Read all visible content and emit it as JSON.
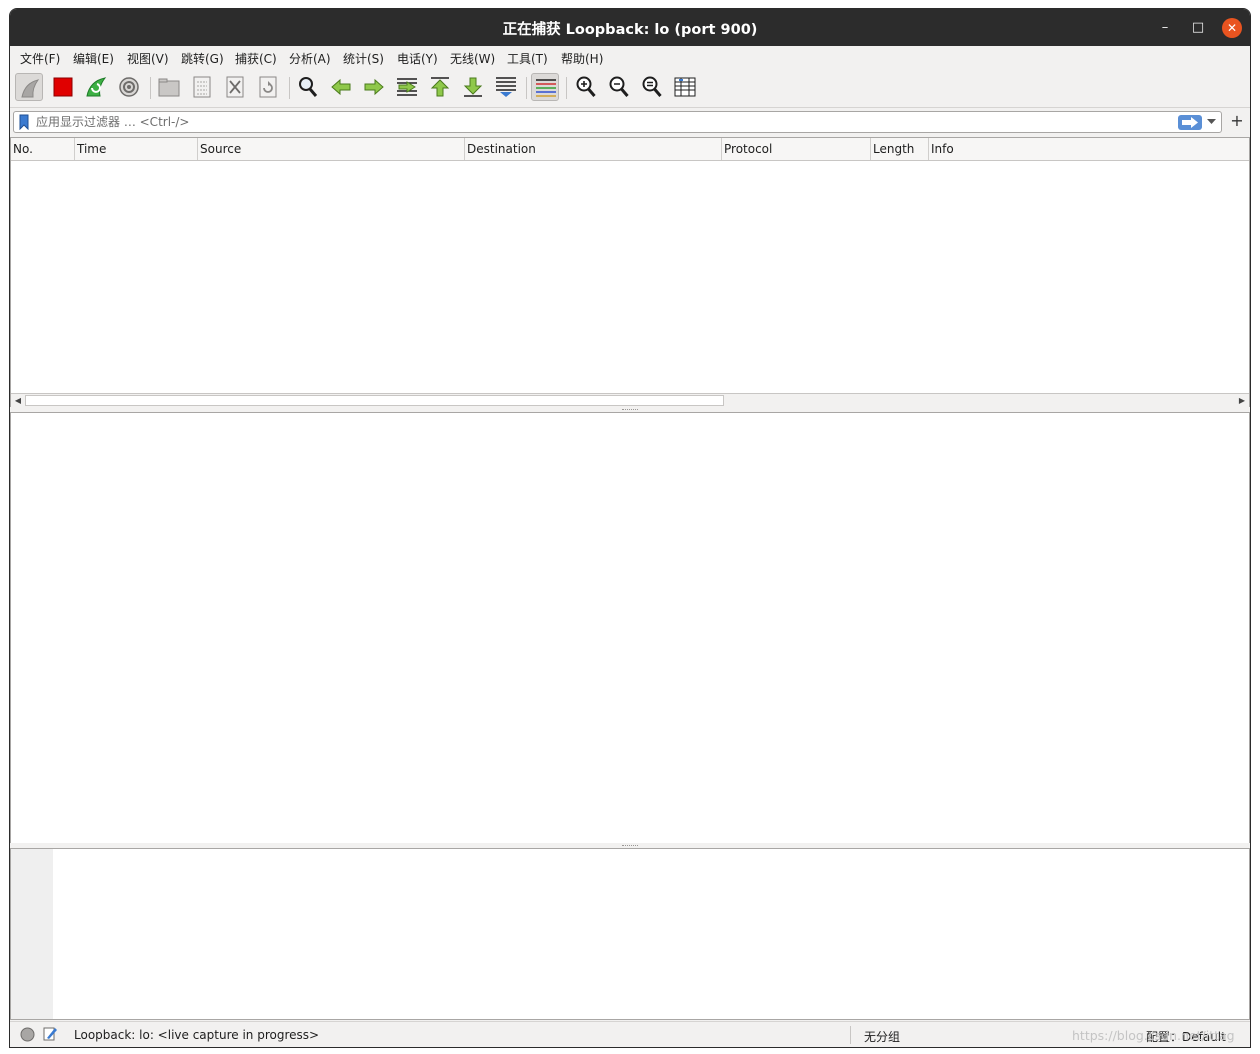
{
  "window": {
    "title": "正在捕获 Loopback: lo (port 900)",
    "controls": {
      "minimize": "–",
      "maximize": "□",
      "close": "✕"
    }
  },
  "menu": [
    "文件(F)",
    "编辑(E)",
    "视图(V)",
    "跳转(G)",
    "捕获(C)",
    "分析(A)",
    "统计(S)",
    "电话(Y)",
    "无线(W)",
    "工具(T)",
    "帮助(H)"
  ],
  "toolbar": {
    "icons": [
      "shark-fin-start-icon",
      "stop-capture-icon",
      "restart-capture-icon",
      "capture-options-gear-icon",
      "open-file-icon",
      "save-file-icon",
      "close-file-icon",
      "reload-file-icon",
      "find-packet-icon",
      "go-back-icon",
      "go-forward-icon",
      "go-to-packet-icon",
      "go-first-packet-icon",
      "go-last-packet-icon",
      "auto-scroll-icon",
      "colorize-icon",
      "zoom-in-icon",
      "zoom-out-icon",
      "zoom-normal-icon",
      "resize-columns-icon"
    ],
    "colors": {
      "stop": "#e00000",
      "arrow_green": "#5aa02c",
      "shark_green": "#3cb043"
    }
  },
  "filter": {
    "placeholder": "应用显示过滤器 … <Ctrl-/>",
    "add_label": "+"
  },
  "packet_list": {
    "columns": [
      "No.",
      "Time",
      "Source",
      "Destination",
      "Protocol",
      "Length",
      "Info"
    ],
    "rows": []
  },
  "status": {
    "capture_label": "Loopback: lo: <live capture in progress>",
    "packets_label": "无分组",
    "profile_label": "配置：Default",
    "watermark": "https://blog.csdn.net/ittag"
  }
}
